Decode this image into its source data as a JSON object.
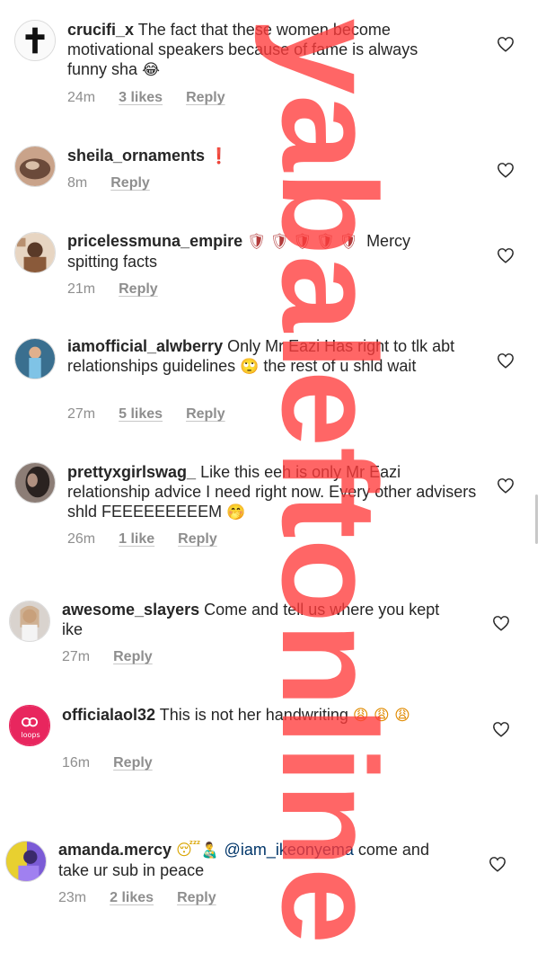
{
  "comments": [
    {
      "username": "crucifi_x",
      "text": "The fact that these women become motivational speakers because of fame is always funny sha",
      "emoji": "😂",
      "time": "24m",
      "likes": "3 likes",
      "reply": "Reply"
    },
    {
      "username": "sheila_ornaments",
      "text": "",
      "emoji": "❗",
      "time": "8m",
      "likes": "",
      "reply": "Reply"
    },
    {
      "username": "pricelessmuna_empire",
      "emoji": "🛡🛡🛡🛡🛡",
      "text": "Mercy spitting facts",
      "time": "21m",
      "likes": "",
      "reply": "Reply"
    },
    {
      "username": "iamofficial_alwberry",
      "text": "Only Mr Eazi Has right to tlk abt relationships guidelines",
      "emoji": "🙄",
      "text_after": "the rest of u shld wait",
      "time": "27m",
      "likes": "5 likes",
      "reply": "Reply"
    },
    {
      "username": "prettyxgirlswag_",
      "text": "Like this eeh is only Mr Eazi relationship advice I need right now. Every other advisers shld FEEEEEEEEEM",
      "emoji": "🤭",
      "time": "26m",
      "likes": "1 like",
      "reply": "Reply"
    },
    {
      "username": "awesome_slayers",
      "text": "Come and tell us where you kept ike",
      "time": "27m",
      "likes": "",
      "reply": "Reply"
    },
    {
      "username": "officialaol32",
      "text": "This is not her handwriting",
      "emoji": "😩 😩 😩",
      "time": "16m",
      "likes": "",
      "reply": "Reply",
      "avatar_label": "loops"
    },
    {
      "username": "amanda.mercy",
      "emoji": "😴👨‍🍼",
      "mention": "@iam_ikeonyema",
      "text": "come and take ur sub in peace",
      "time": "23m",
      "likes": "2 likes",
      "reply": "Reply"
    }
  ],
  "watermark": {
    "text": "yabaleftonline",
    "color": "#ff3b3b"
  },
  "colors": {
    "text": "#262626",
    "meta": "#8e8e8e",
    "mention": "#003569",
    "loops_avatar": "#e8265e"
  }
}
